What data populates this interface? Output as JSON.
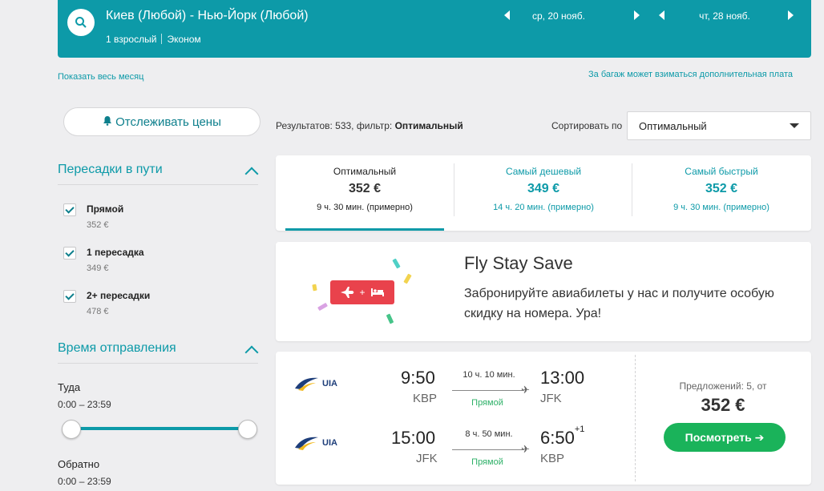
{
  "header": {
    "route": "Киев (Любой) - Нью-Йорк (Любой)",
    "passengers": "1 взрослый",
    "cabin": "Эконом",
    "depart_date": "ср, 20 нояб.",
    "return_date": "чт, 28 нояб."
  },
  "links": {
    "show_month": "Показать весь месяц",
    "baggage_note": "За багаж может взиматься дополнительная плата"
  },
  "sidebar": {
    "track_prices": "Отслеживать цены",
    "stops_title": "Пересадки в пути",
    "stops": [
      {
        "label": "Прямой",
        "price": "352 €",
        "checked": true
      },
      {
        "label": "1 пересадка",
        "price": "349 €",
        "checked": true
      },
      {
        "label": "2+ пересадки",
        "price": "478 €",
        "checked": true
      }
    ],
    "departure_title": "Время отправления",
    "outbound_label": "Туда",
    "outbound_range": "0:00 – 23:59",
    "return_label": "Обратно",
    "return_range": "0:00 – 23:59"
  },
  "results": {
    "count_label": "Результатов: 533, фильтр:",
    "filter": "Оптимальный",
    "sort_label": "Сортировать по",
    "sort_value": "Оптимальный"
  },
  "tabs": [
    {
      "title": "Оптимальный",
      "price": "352 €",
      "duration": "9 ч. 30 мин. (примерно)"
    },
    {
      "title": "Самый дешевый",
      "price": "349 €",
      "duration": "14 ч. 20 мин. (примерно)"
    },
    {
      "title": "Самый быстрый",
      "price": "352 €",
      "duration": "9 ч. 30 мин. (примерно)"
    }
  ],
  "promo": {
    "title": "Fly Stay Save",
    "text": "Забронируйте авиабилеты у нас и получите особую скидку на номера. Ура!"
  },
  "flight": {
    "legs": [
      {
        "airline": "UIA",
        "dep_time": "9:50",
        "dep_code": "KBP",
        "duration": "10 ч. 10 мин.",
        "stops": "Прямой",
        "arr_time": "13:00",
        "arr_code": "JFK",
        "day_offset": ""
      },
      {
        "airline": "UIA",
        "dep_time": "15:00",
        "dep_code": "JFK",
        "duration": "8 ч. 50 мин.",
        "stops": "Прямой",
        "arr_time": "6:50",
        "arr_code": "KBP",
        "day_offset": "+1"
      }
    ],
    "offers": "Предложений: 5, от",
    "price": "352 €",
    "view_button": "Посмотреть ➔"
  },
  "colors": {
    "accent": "#0d9aa8",
    "green": "#1ab35a",
    "promo_red": "#e9424c"
  }
}
